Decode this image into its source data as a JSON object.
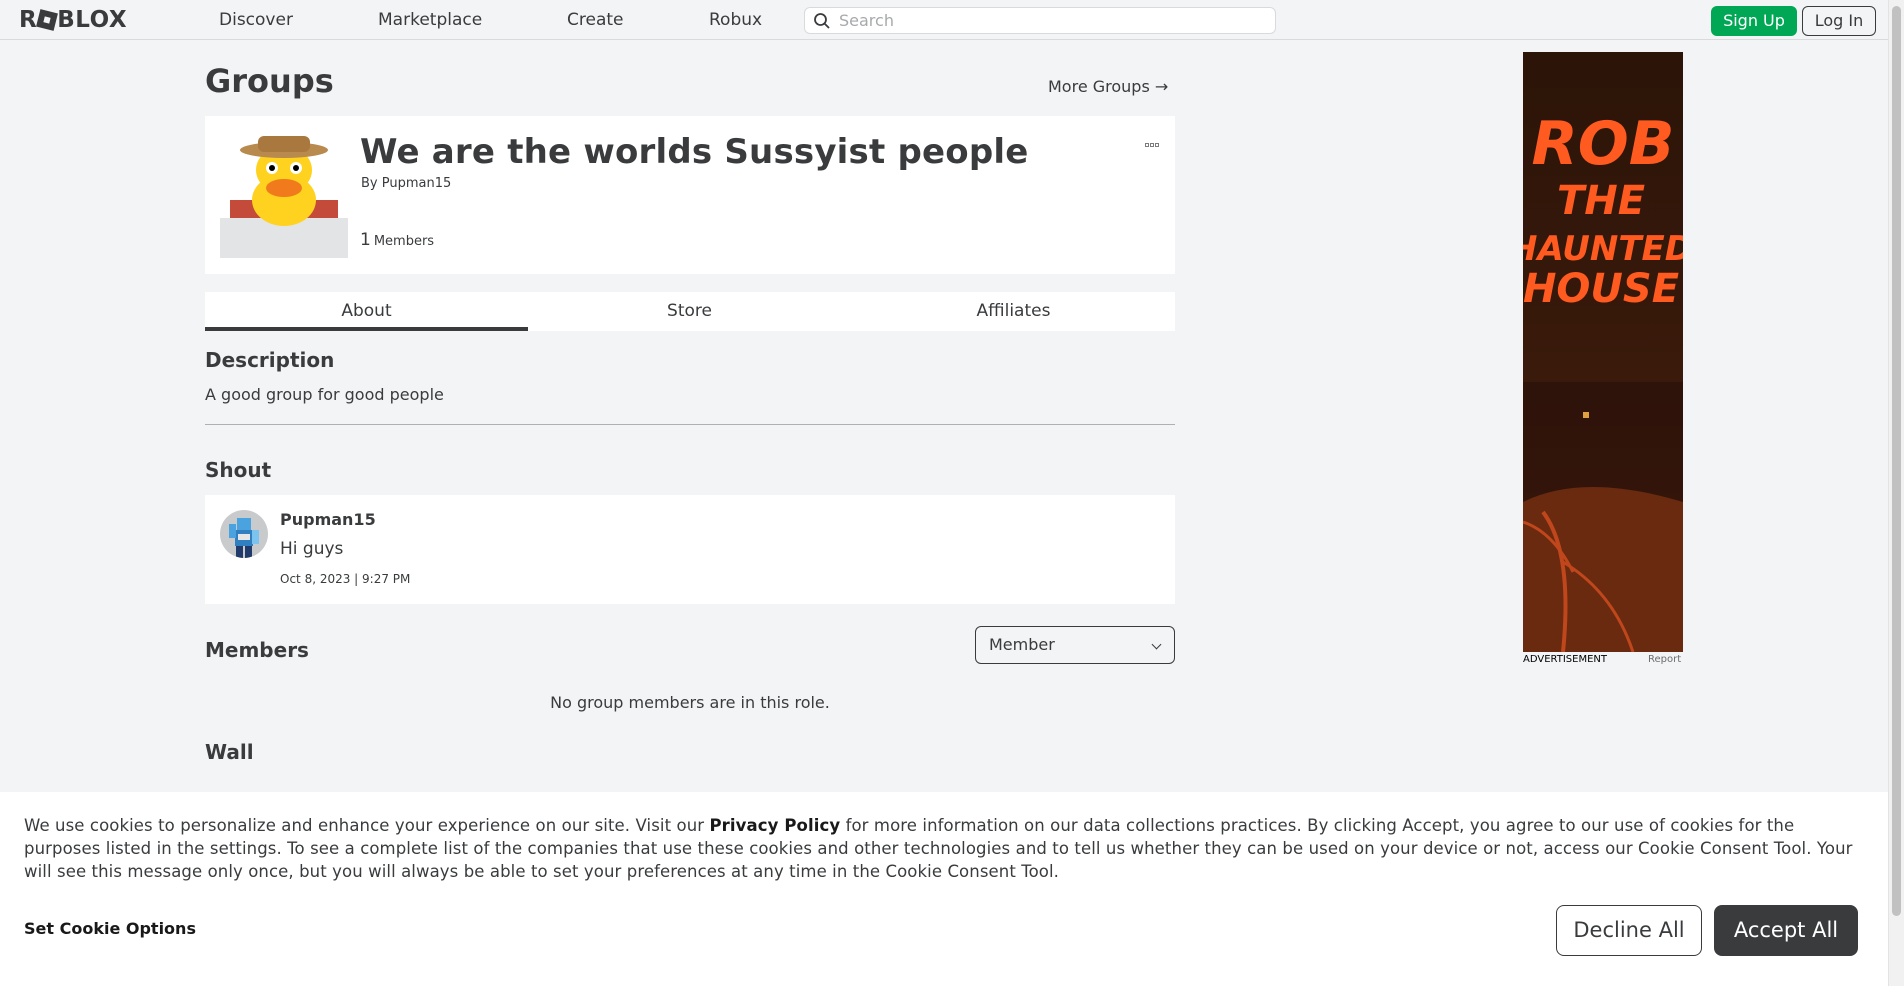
{
  "nav": {
    "logo": "ROBLOX",
    "items": [
      "Discover",
      "Marketplace",
      "Create",
      "Robux"
    ],
    "search_placeholder": "Search",
    "signup": "Sign Up",
    "login": "Log In"
  },
  "page": {
    "title": "Groups",
    "more_groups": "More Groups →"
  },
  "group": {
    "name": "We are the worlds Sussyist people",
    "by_prefix": "By",
    "owner": "Pupman15",
    "member_count": "1",
    "members_label": "Members"
  },
  "tabs": [
    "About",
    "Store",
    "Affiliates"
  ],
  "about": {
    "description_heading": "Description",
    "description": "A good group for good people",
    "shout_heading": "Shout",
    "shout": {
      "user": "Pupman15",
      "body": "Hi guys",
      "date": "Oct 8, 2023 | 9:27 PM"
    },
    "members_heading": "Members",
    "role_selected": "Member",
    "empty_role": "No group members are in this role.",
    "wall_heading": "Wall"
  },
  "ad": {
    "lines": [
      "ROB",
      "THE",
      "HAUNTED",
      "HOUSE"
    ],
    "caption": "ADVERTISEMENT",
    "report": "Report"
  },
  "cookie": {
    "text_1": "We use cookies to personalize and enhance your experience on our site. Visit our ",
    "privacy_link": "Privacy Policy",
    "text_2": " for more information on our data collections practices. By clicking Accept, you agree to our use of cookies for the purposes listed in the settings. To see a complete list of the companies that use these cookies and other technologies and to tell us whether they can be used on your device or not, access our Cookie Consent Tool. Your will see this message only once, but you will always be able to set your preferences at any time in the Cookie Consent Tool.",
    "set_options": "Set Cookie Options",
    "decline": "Decline All",
    "accept": "Accept All"
  }
}
